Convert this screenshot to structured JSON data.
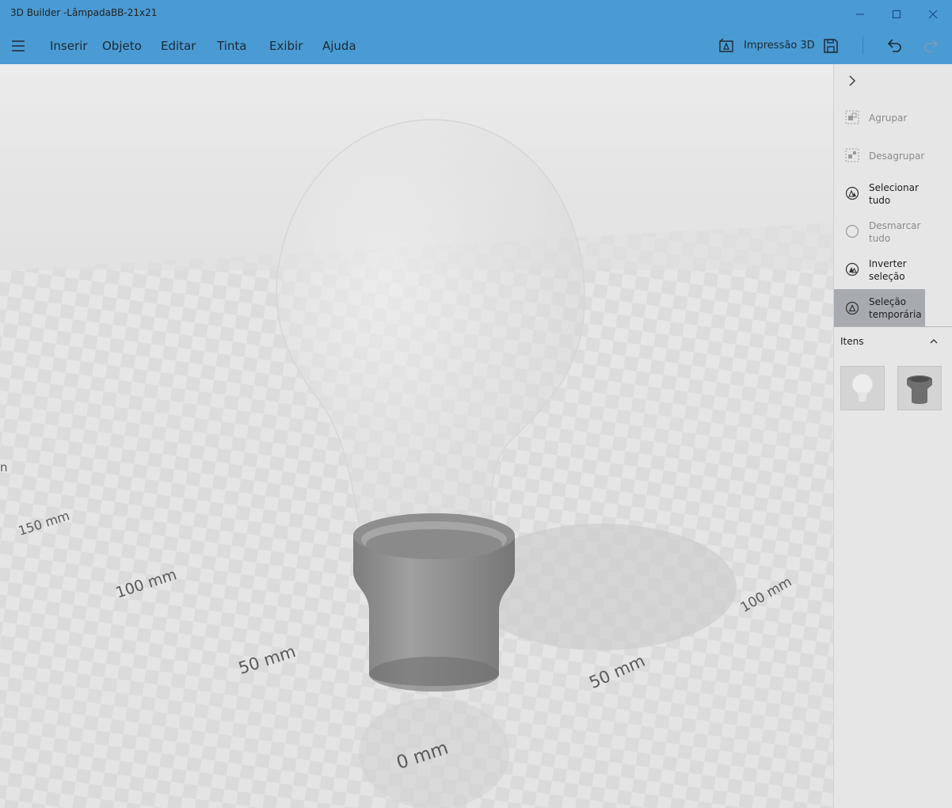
{
  "window": {
    "title": "3D Builder -LâmpadaBB-21x21"
  },
  "menu": {
    "items": [
      "Inserir",
      "Objeto",
      "Editar",
      "Tinta",
      "Exibir",
      "Ajuda"
    ],
    "print_label": "Impressão 3D"
  },
  "viewport": {
    "left_labels": [
      "150 mm",
      "100 mm",
      "50 mm",
      "0 mm"
    ],
    "right_labels": [
      "50 mm",
      "100 mm"
    ],
    "edge_fragment": "n"
  },
  "panel": {
    "actions": [
      {
        "label": "Agrupar",
        "icon": "group-icon",
        "enabled": false
      },
      {
        "label": "Desagrupar",
        "icon": "ungroup-icon",
        "enabled": false
      },
      {
        "label": "Selecionar tudo",
        "icon": "select-all-icon",
        "enabled": true
      },
      {
        "label": "Desmarcar tudo",
        "icon": "deselect-all-icon",
        "enabled": false
      },
      {
        "label": "Inverter seleção",
        "icon": "invert-selection-icon",
        "enabled": true
      },
      {
        "label_line1": "Seleção",
        "label_line2": "temporária",
        "icon": "temporary-selection-icon",
        "enabled": true,
        "active": true
      }
    ],
    "items_label": "Itens",
    "items": [
      {
        "icon": "bulb-thumbnail"
      },
      {
        "icon": "socket-thumbnail"
      }
    ]
  },
  "colors": {
    "title_bar": "#4a9bd3",
    "panel": "#e6e6e6",
    "active_action": "#a7abb0"
  }
}
